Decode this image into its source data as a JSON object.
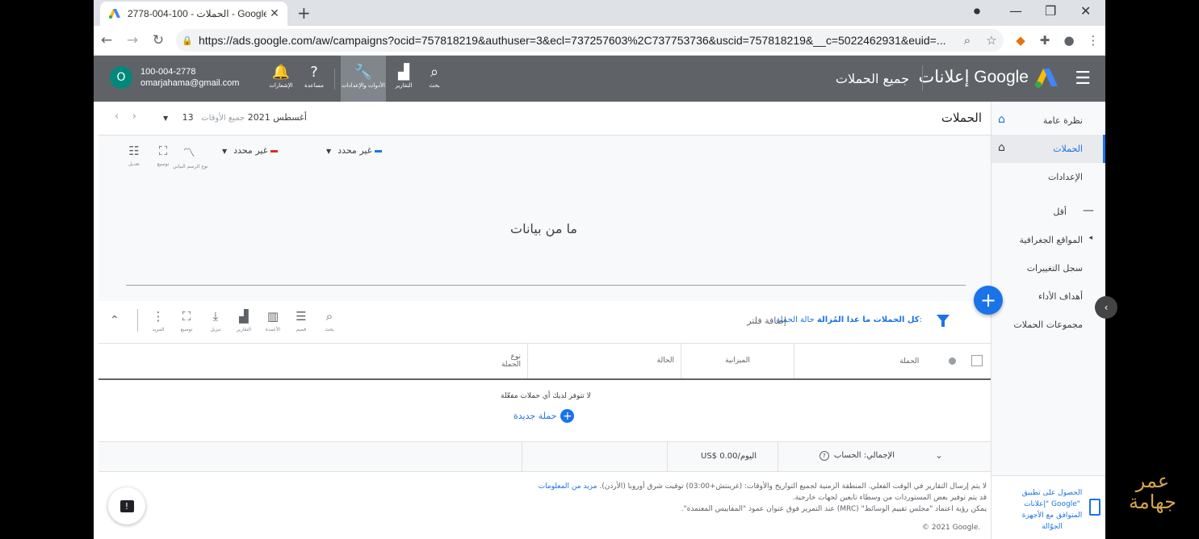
{
  "browser": {
    "tab_title": "الحملات - 100-004-2778 - Google",
    "new_tab": "+",
    "url": "https://ads.google.com/aw/campaigns?ocid=757818219&authuser=3&ecl=737257603%2C737753736&uscid=757818219&__c=5022462931&euid=...",
    "window_controls": [
      "—",
      "❐",
      "✕"
    ]
  },
  "header": {
    "brand": "إعلانات Google",
    "section": "جميع الحملات",
    "tools": [
      {
        "icon": "search-icon",
        "label": "بحث"
      },
      {
        "icon": "reports-icon",
        "label": "التقارير"
      },
      {
        "icon": "wrench-icon",
        "label": "الأدوات والإعدادات"
      },
      {
        "icon": "help-icon",
        "label": "مساعدة"
      },
      {
        "icon": "bell-icon",
        "label": "الإشعارات"
      }
    ],
    "account_id": "100-004-2778",
    "account_email": "omarjahama@gmail.com",
    "avatar_letter": "O"
  },
  "sidebar": {
    "items": [
      {
        "label": "نظرة عامة",
        "icon": "home-icon"
      },
      {
        "label": "الحملات",
        "icon": "home-icon"
      },
      {
        "label": "الإعدادات"
      },
      {
        "label": "أقل"
      },
      {
        "label": "المواقع الجغرافية"
      },
      {
        "label": "سجل التغييرات"
      },
      {
        "label": "أهداف الأداء"
      },
      {
        "label": "مجموعات الحملات"
      }
    ],
    "footer_text": "الحصول على تطبيق \"إعلانات Google\" المتوافق مع الأجهزة الجوّالة"
  },
  "page": {
    "title": "الحملات",
    "date_label": "جميع الأوقات",
    "date_value": "13 أغسطس 2021"
  },
  "chart": {
    "metric1": "غير محدد",
    "metric2": "غير محدد",
    "metric1_color": "#1a73e8",
    "metric2_color": "#d93025",
    "tools": [
      {
        "icon": "chart-type-icon",
        "label": "نوع الرسم البياني"
      },
      {
        "icon": "expand-icon",
        "label": "توسيع"
      },
      {
        "icon": "adjust-icon",
        "label": "تعديل"
      }
    ],
    "no_data": "ما من بيانات"
  },
  "filterbar": {
    "filter_prefix": "حالة الحملة:",
    "filter_value": "كل الحملات ما عدا المُزالة",
    "add_filter": "إضافة فلتر",
    "tools": [
      {
        "icon": "search-icon",
        "label": "بحث"
      },
      {
        "icon": "segment-icon",
        "label": "قسم"
      },
      {
        "icon": "columns-icon",
        "label": "الأعمدة"
      },
      {
        "icon": "reports-icon",
        "label": "التقارير"
      },
      {
        "icon": "download-icon",
        "label": "تنزيل"
      },
      {
        "icon": "expand-icon",
        "label": "توسيع"
      },
      {
        "icon": "more-icon",
        "label": "المزيد"
      }
    ]
  },
  "table": {
    "columns": [
      "الحملة",
      "الميزانية",
      "الحالة",
      "نوع الحملة"
    ],
    "empty_message": "لا تتوفر لديك أي حملات مفعّلة",
    "new_campaign": "حملة جديدة",
    "total_label": "الإجمالي: الحساب",
    "total_budget": "US$ 0.00/اليوم"
  },
  "footer": {
    "line1": "لا يتم إرسال التقارير في الوقت الفعلي. المنطقة الزمنية لجميع التواريخ والأوقات: (غرينتش+03:00) توقيت شرق أوروبا (الأردن).",
    "line1_link": "مزيد من المعلومات",
    "line2": "قد يتم توفير بعض المستوردات من وسطاء تابعين لجهات خارجية.",
    "line3": "يمكن رؤية اعتماد \"مجلس تقييم الوسائط\" (MRC) عند التمرير فوق عنوان عمود \"المقاييس المعتمدة\".",
    "copyright": "© 2021 Google."
  },
  "watermark": {
    "line1": "عمر",
    "line2": "جهامة"
  }
}
